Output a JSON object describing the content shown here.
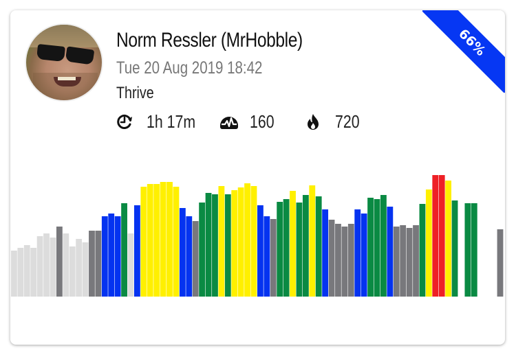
{
  "card": {
    "user_name": "Norm Ressler (MrHobble)",
    "date": "Tue 20 Aug 2019 18:42",
    "workout": "Thrive",
    "stats": [
      {
        "icon": "duration-clock-icon",
        "value": "1h 17m"
      },
      {
        "icon": "heart-rate-pulse-icon",
        "value": "160"
      },
      {
        "icon": "flame-calories-icon",
        "value": "720"
      }
    ],
    "ribbon": {
      "label": "66%",
      "color": "#0637f3"
    }
  },
  "chart_data": {
    "type": "bar",
    "title": "",
    "xlabel": "",
    "ylabel": "",
    "ylim": [
      0,
      177
    ],
    "zone_colors": {
      "zone0": "#dcdcdc",
      "zone1": "#78787c",
      "zone2": "#0533f0",
      "zone3": "#0a8a43",
      "zone4": "#fff000",
      "zone5": "#ee2026",
      "none": "transparent"
    },
    "bars": [
      {
        "v": 67,
        "z": "zone0"
      },
      {
        "v": 71,
        "z": "zone0"
      },
      {
        "v": 75,
        "z": "zone0"
      },
      {
        "v": 71,
        "z": "zone0"
      },
      {
        "v": 88,
        "z": "zone0"
      },
      {
        "v": 92,
        "z": "zone0"
      },
      {
        "v": 86,
        "z": "zone0"
      },
      {
        "v": 102,
        "z": "zone1"
      },
      {
        "v": 92,
        "z": "zone0"
      },
      {
        "v": 73,
        "z": "zone0"
      },
      {
        "v": 84,
        "z": "zone0"
      },
      {
        "v": 79,
        "z": "zone0"
      },
      {
        "v": 96,
        "z": "zone1"
      },
      {
        "v": 96,
        "z": "zone1"
      },
      {
        "v": 117,
        "z": "zone2"
      },
      {
        "v": 121,
        "z": "zone2"
      },
      {
        "v": 117,
        "z": "zone2"
      },
      {
        "v": 136,
        "z": "zone3"
      },
      {
        "v": 92,
        "z": "zone0"
      },
      {
        "v": 133,
        "z": "zone2"
      },
      {
        "v": 160,
        "z": "zone4"
      },
      {
        "v": 164,
        "z": "zone4"
      },
      {
        "v": 164,
        "z": "zone4"
      },
      {
        "v": 167,
        "z": "zone4"
      },
      {
        "v": 167,
        "z": "zone4"
      },
      {
        "v": 160,
        "z": "zone4"
      },
      {
        "v": 129,
        "z": "zone2"
      },
      {
        "v": 117,
        "z": "zone2"
      },
      {
        "v": 110,
        "z": "zone1"
      },
      {
        "v": 137,
        "z": "zone3"
      },
      {
        "v": 151,
        "z": "zone3"
      },
      {
        "v": 149,
        "z": "zone3"
      },
      {
        "v": 161,
        "z": "zone4"
      },
      {
        "v": 149,
        "z": "zone3"
      },
      {
        "v": 155,
        "z": "zone4"
      },
      {
        "v": 159,
        "z": "zone4"
      },
      {
        "v": 165,
        "z": "zone4"
      },
      {
        "v": 161,
        "z": "zone4"
      },
      {
        "v": 133,
        "z": "zone2"
      },
      {
        "v": 117,
        "z": "zone2"
      },
      {
        "v": 113,
        "z": "zone1"
      },
      {
        "v": 138,
        "z": "zone3"
      },
      {
        "v": 142,
        "z": "zone3"
      },
      {
        "v": 154,
        "z": "zone4"
      },
      {
        "v": 137,
        "z": "zone3"
      },
      {
        "v": 148,
        "z": "zone3"
      },
      {
        "v": 162,
        "z": "zone4"
      },
      {
        "v": 146,
        "z": "zone3"
      },
      {
        "v": 127,
        "z": "zone2"
      },
      {
        "v": 112,
        "z": "zone1"
      },
      {
        "v": 106,
        "z": "zone1"
      },
      {
        "v": 102,
        "z": "zone1"
      },
      {
        "v": 106,
        "z": "zone1"
      },
      {
        "v": 127,
        "z": "zone2"
      },
      {
        "v": 121,
        "z": "zone2"
      },
      {
        "v": 144,
        "z": "zone3"
      },
      {
        "v": 142,
        "z": "zone3"
      },
      {
        "v": 148,
        "z": "zone3"
      },
      {
        "v": 131,
        "z": "zone2"
      },
      {
        "v": 102,
        "z": "zone1"
      },
      {
        "v": 104,
        "z": "zone1"
      },
      {
        "v": 100,
        "z": "zone1"
      },
      {
        "v": 104,
        "z": "zone1"
      },
      {
        "v": 135,
        "z": "zone3"
      },
      {
        "v": 156,
        "z": "zone4"
      },
      {
        "v": 177,
        "z": "zone5"
      },
      {
        "v": 177,
        "z": "zone5"
      },
      {
        "v": 169,
        "z": "zone4"
      },
      {
        "v": 140,
        "z": "zone3"
      },
      {
        "v": 0,
        "z": "none"
      },
      {
        "v": 136,
        "z": "zone3"
      },
      {
        "v": 136,
        "z": "zone3"
      },
      {
        "v": 0,
        "z": "none"
      },
      {
        "v": 0,
        "z": "none"
      },
      {
        "v": 0,
        "z": "none"
      },
      {
        "v": 98,
        "z": "zone1"
      }
    ]
  }
}
